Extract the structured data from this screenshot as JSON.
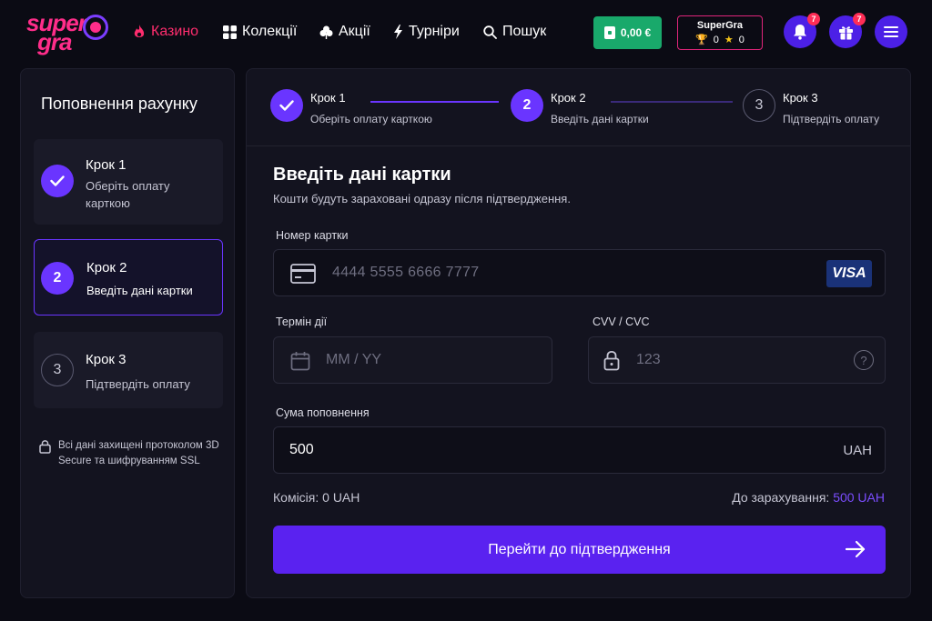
{
  "header": {
    "logo_line1": "super",
    "logo_line2": "gra",
    "nav": {
      "casino": "Казино",
      "collections": "Колекції",
      "promotions": "Акції",
      "tournaments": "Турніри",
      "search": "Пошук"
    },
    "balance": "0,00 €",
    "profile": {
      "name": "SuperGra",
      "trophies": "0",
      "stars": "0"
    },
    "notifications_count": "7",
    "gifts_count": "7"
  },
  "sidebar": {
    "title": "Поповнення рахунку",
    "steps": [
      {
        "number": "1",
        "title": "Крок 1",
        "subtitle": "Оберіть оплату карткою",
        "state": "done"
      },
      {
        "number": "2",
        "title": "Крок 2",
        "subtitle": "Введіть дані картки",
        "state": "active"
      },
      {
        "number": "3",
        "title": "Крок 3",
        "subtitle": "Підтвердіть оплату",
        "state": "pending"
      }
    ],
    "security_note": "Всі дані захищені протоколом 3D Secure та шифруванням SSL"
  },
  "stepper": [
    {
      "number": "1",
      "title": "Крок 1",
      "subtitle": "Оберіть оплату карткою"
    },
    {
      "number": "2",
      "title": "Крок 2",
      "subtitle": "Введіть дані картки"
    },
    {
      "number": "3",
      "title": "Крок 3",
      "subtitle": "Підтвердіть оплату"
    }
  ],
  "form": {
    "title": "Введіть дані картки",
    "subtitle": "Кошти будуть зараховані одразу після підтвердження.",
    "card_number": {
      "label": "Номер картки",
      "placeholder": "4444 5555 6666 7777",
      "brand": "VISA"
    },
    "expiry": {
      "label": "Термін дії",
      "placeholder": "MM / YY"
    },
    "cvv": {
      "label": "CVV / CVC",
      "placeholder": "123",
      "help": "?"
    },
    "amount": {
      "label": "Сума поповнення",
      "value": "500",
      "currency": "UAH"
    },
    "fee_text": "Комісія: 0 UAH",
    "credit_label": "До зарахування:",
    "credit_amount": "500 UAH",
    "submit_label": "Перейти до підтвердження"
  },
  "colors": {
    "accent": "#6a35ff",
    "brand_pink": "#ff2d8a",
    "balance_green": "#19a96b",
    "background": "#0b0b14",
    "panel": "#13131f"
  }
}
